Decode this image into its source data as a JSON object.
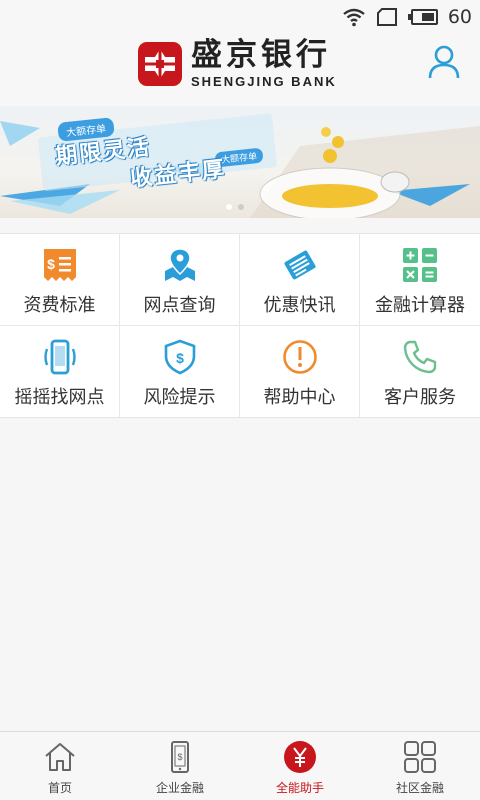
{
  "status_bar": {
    "battery_level": "60"
  },
  "header": {
    "brand_cn": "盛京银行",
    "brand_en": "SHENGJING BANK"
  },
  "banner": {
    "tag_primary": "大额存单",
    "tag_secondary": "大额存单",
    "headline_1": "期限灵活",
    "headline_2": "收益丰厚"
  },
  "services": [
    {
      "label": "资费标准",
      "icon": "fee-receipt-icon",
      "color": "#f08a2c"
    },
    {
      "label": "网点查询",
      "icon": "map-pin-icon",
      "color": "#2a9ed8"
    },
    {
      "label": "优惠快讯",
      "icon": "newspaper-icon",
      "color": "#2a9ed8"
    },
    {
      "label": "金融计算器",
      "icon": "calculator-icon",
      "color": "#55c08a"
    },
    {
      "label": "摇摇找网点",
      "icon": "shake-phone-icon",
      "color": "#2a9ed8"
    },
    {
      "label": "风险提示",
      "icon": "shield-dollar-icon",
      "color": "#2a9ed8"
    },
    {
      "label": "帮助中心",
      "icon": "exclamation-circle-icon",
      "color": "#f08a2c"
    },
    {
      "label": "客户服务",
      "icon": "phone-handset-icon",
      "color": "#6cc08e"
    }
  ],
  "tabs": [
    {
      "label": "首页",
      "icon": "home-icon",
      "active": false
    },
    {
      "label": "企业金融",
      "icon": "phone-dollar-icon",
      "active": false
    },
    {
      "label": "全能助手",
      "icon": "yuan-circle-icon",
      "active": true
    },
    {
      "label": "社区金融",
      "icon": "grid-squares-icon",
      "active": false
    }
  ],
  "colors": {
    "brand_red": "#c8161d",
    "accent_blue": "#2a9ed8"
  }
}
